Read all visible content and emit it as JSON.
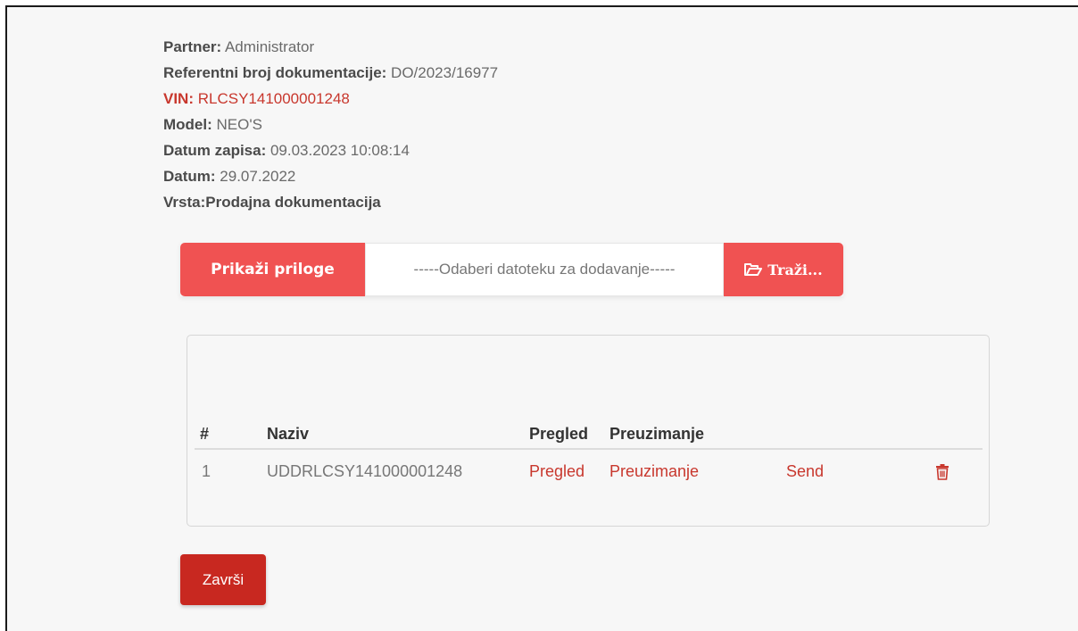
{
  "details": {
    "partner_label": "Partner:",
    "partner_value": " Administrator",
    "ref_label": "Referentni broj dokumentacije:",
    "ref_value": " DO/2023/16977",
    "vin_label": "VIN:",
    "vin_value": " RLCSY141000001248",
    "model_label": "Model:",
    "model_value": " NEO'S",
    "record_date_label": "Datum zapisa:",
    "record_date_value": " 09.03.2023 10:08:14",
    "date_label": "Datum:",
    "date_value": " 29.07.2022",
    "type_label": "Vrsta:",
    "type_value": "Prodajna dokumentacija"
  },
  "upload": {
    "show_button": "Prikaži priloge",
    "file_placeholder": "-----Odaberi datoteku za dodavanje-----",
    "browse_button": "Traži...",
    "browse_icon": "folder-open-icon"
  },
  "table": {
    "headers": [
      "#",
      "Naziv",
      "Pregled",
      "Preuzimanje"
    ],
    "rows": [
      {
        "index": "1",
        "name": "UDDRLCSY141000001248",
        "preview": "Pregled",
        "download": "Preuzimanje",
        "send": "Send",
        "delete_icon": "trash-icon"
      }
    ]
  },
  "footer": {
    "finish_button": "Završi"
  },
  "colors": {
    "accent": "#f05252",
    "dark_accent": "#c82820",
    "link": "#c8372d"
  }
}
